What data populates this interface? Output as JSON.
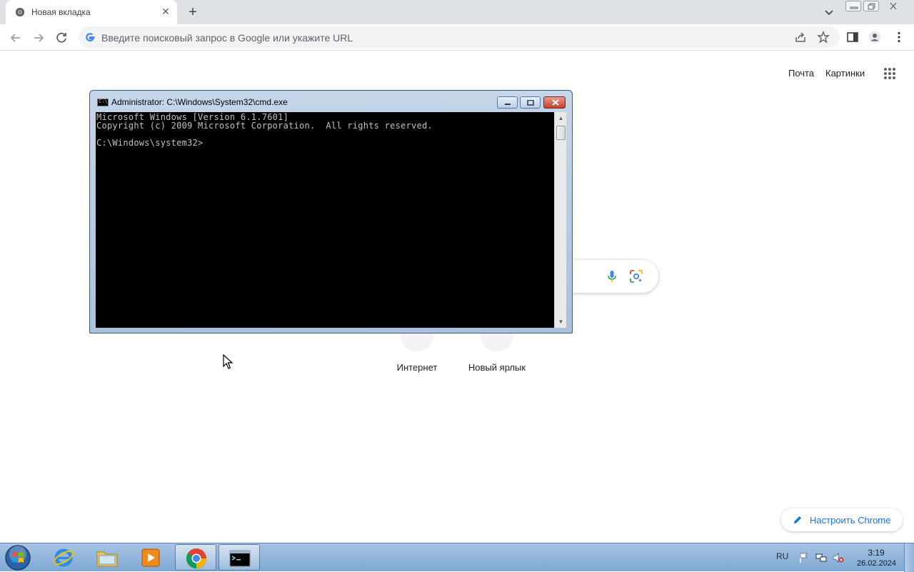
{
  "browser": {
    "tab": {
      "title": "Новая вкладка",
      "close": "✕"
    },
    "new_tab": "+",
    "omnibox": {
      "placeholder": "Введите поисковый запрос в Google или укажите URL"
    }
  },
  "ntp": {
    "links": {
      "mail": "Почта",
      "images": "Картинки"
    },
    "shortcuts": [
      {
        "label": "Интернет"
      },
      {
        "label": "Новый ярлык"
      }
    ],
    "customize": "Настроить Chrome"
  },
  "cmd": {
    "title": "Administrator: C:\\Windows\\System32\\cmd.exe",
    "icon_text": "C:\\",
    "lines": [
      "Microsoft Windows [Version 6.1.7601]",
      "Copyright (c) 2009 Microsoft Corporation.  All rights reserved.",
      "",
      "C:\\Windows\\system32>"
    ]
  },
  "taskbar": {
    "language": "RU",
    "clock": {
      "time": "3:19",
      "date": "26.02.2024"
    }
  },
  "colors": {
    "accent": "#1a73e8",
    "console_bg": "#000000",
    "console_text": "#c0c0c0"
  }
}
